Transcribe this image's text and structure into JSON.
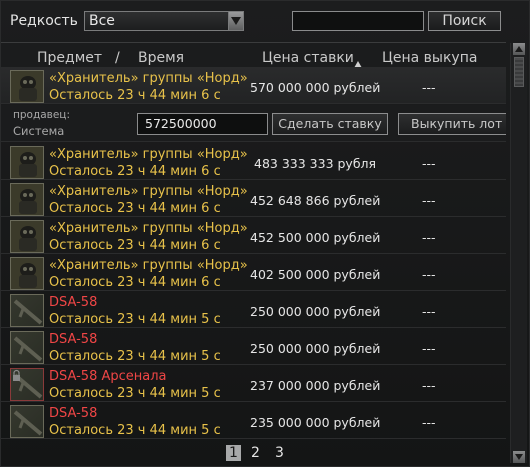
{
  "filter": {
    "rarity_label": "Редкость",
    "rarity_value": "Все",
    "search_value": "",
    "search_button": "Поиск"
  },
  "header": {
    "item": "Предмет",
    "slash": "/",
    "time": "Время",
    "bid_price": "Цена ставки",
    "buyout_price": "Цена выкупа"
  },
  "selected": {
    "name": "«Хранитель» группы «Норд»",
    "time": "Осталось 23 ч 44 мин 6 с",
    "price": "570 000 000 рублей",
    "buyout": "---",
    "seller_label": "продавец:",
    "seller_name": "Система",
    "bid_value": "572500000",
    "bid_button": "Сделать ставку",
    "buyout_button": "Выкупить лот"
  },
  "rows": [
    {
      "name": "«Хранитель» группы «Норд»",
      "time": "Осталось 23 ч 44 мин 6 с",
      "price": "483 333 333 рубля",
      "buyout": "---",
      "icon": "armor-icon"
    },
    {
      "name": "«Хранитель» группы «Норд»",
      "time": "Осталось 23 ч 44 мин 6 с",
      "price": "452 648 866 рублей",
      "buyout": "---",
      "icon": "armor-icon"
    },
    {
      "name": "«Хранитель» группы «Норд»",
      "time": "Осталось 23 ч 44 мин 6 с",
      "price": "452 500 000 рублей",
      "buyout": "---",
      "icon": "armor-icon"
    },
    {
      "name": "«Хранитель» группы «Норд»",
      "time": "Осталось 23 ч 44 мин 6 с",
      "price": "402 500 000 рублей",
      "buyout": "---",
      "icon": "armor-icon"
    },
    {
      "name": "DSA-58",
      "time": "Осталось 23 ч 44 мин 5 с",
      "price": "250 000 000 рублей",
      "buyout": "---",
      "icon": "rifle-icon"
    },
    {
      "name": "DSA-58",
      "time": "Осталось 23 ч 44 мин 5 с",
      "price": "250 000 000 рублей",
      "buyout": "---",
      "icon": "rifle-icon"
    },
    {
      "name": "DSA-58 Арсенала",
      "time": "Осталось 23 ч 44 мин 5 с",
      "price": "237 000 000 рублей",
      "buyout": "---",
      "icon": "rifle-icon"
    },
    {
      "name": "DSA-58",
      "time": "Осталось 23 ч 44 мин 5 с",
      "price": "235 000 000 рублей",
      "buyout": "---",
      "icon": "rifle-icon"
    }
  ],
  "pagination": {
    "pages": [
      "1",
      "2",
      "3"
    ],
    "current": "1"
  },
  "colors": {
    "gold": "#e8c24a",
    "red": "#f04646",
    "text": "#e6e6e6"
  }
}
